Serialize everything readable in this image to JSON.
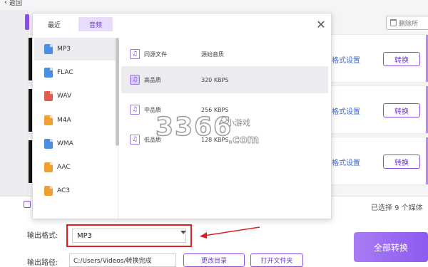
{
  "app": {
    "back_label": "返回",
    "delete_all_label": "删除所"
  },
  "files": [
    {
      "format_settings": "格式设置",
      "convert": "转换"
    },
    {
      "format_settings": "格式设置",
      "convert": "转换"
    },
    {
      "format_settings": "格式设置",
      "convert": "转换"
    }
  ],
  "bottom": {
    "selected_info": "已选择 9 个媒体",
    "output_format_label": "输出格式:",
    "output_format_value": "MP3",
    "output_path_label": "输出路径:",
    "output_path_value": "C:/Users/Videos/转换完成",
    "change_dir_label": "更改目录",
    "open_folder_label": "打开文件夹",
    "convert_all_label": "全部转换"
  },
  "popup": {
    "tabs": [
      {
        "label": "最近",
        "active": false
      },
      {
        "label": "音频",
        "active": true
      }
    ],
    "formats": [
      {
        "label": "MP3",
        "color": "#4a90e2",
        "selected": true
      },
      {
        "label": "FLAC",
        "color": "#4a90e2",
        "selected": false
      },
      {
        "label": "WAV",
        "color": "#e35b4f",
        "selected": false
      },
      {
        "label": "M4A",
        "color": "#f0a030",
        "selected": false
      },
      {
        "label": "WMA",
        "color": "#4a90e2",
        "selected": false
      },
      {
        "label": "AAC",
        "color": "#f0a030",
        "selected": false
      },
      {
        "label": "AC3",
        "color": "#f0a030",
        "selected": false
      }
    ],
    "qualities": [
      {
        "name": "同源文件",
        "rate": "源始音质",
        "selected": false
      },
      {
        "name": "高品质",
        "rate": "320 KBPS",
        "selected": true
      },
      {
        "name": "中品质",
        "rate": "256 KBPS",
        "selected": false
      },
      {
        "name": "低品质",
        "rate": "128 KBPS",
        "selected": false
      }
    ]
  },
  "watermark": {
    "number": "3366",
    "text": "小游戏",
    "domain": ".com"
  },
  "colors": {
    "accent": "#8a4fe8",
    "highlight_border": "#e02020",
    "link": "#3a69d6"
  }
}
